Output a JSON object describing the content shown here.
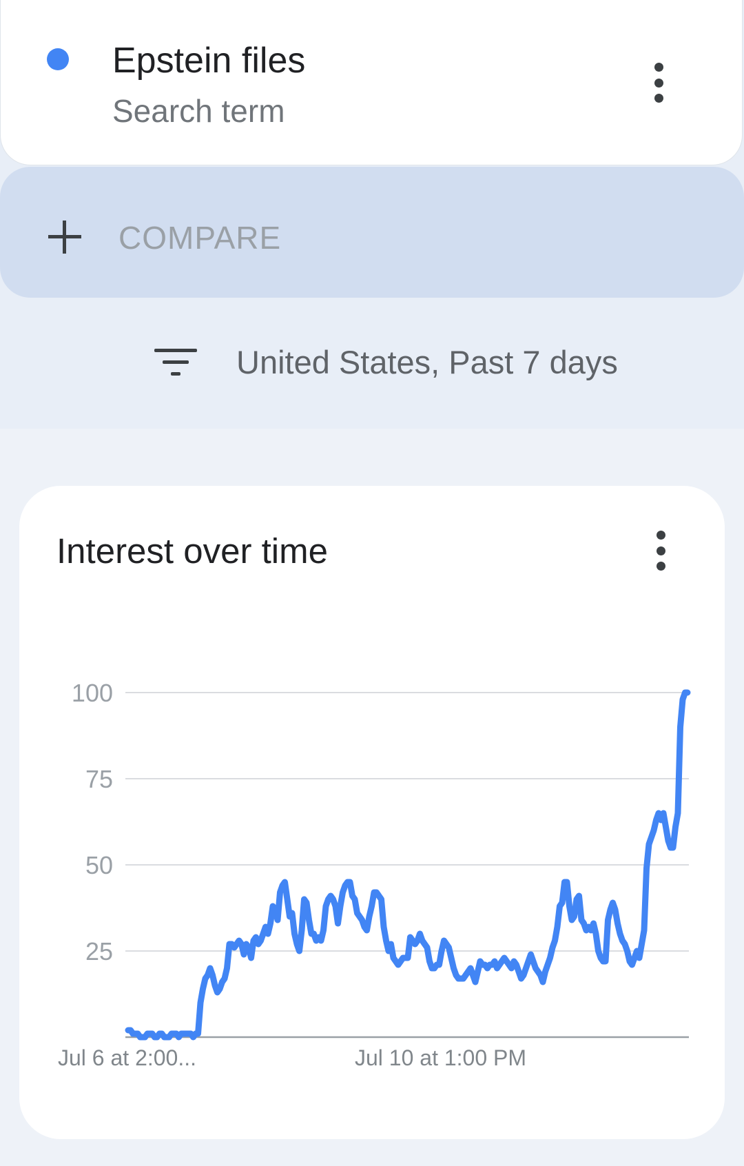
{
  "term": {
    "title": "Epstein files",
    "subtitle": "Search term",
    "dot_color": "#4285f4"
  },
  "compare": {
    "label": "COMPARE"
  },
  "filter": {
    "label": "United States, Past 7 days"
  },
  "chart_card": {
    "title": "Interest over time"
  },
  "chart_data": {
    "type": "line",
    "title": "Interest over time",
    "xlabel": "",
    "ylabel": "",
    "ylim": [
      0,
      100
    ],
    "yticks": [
      100,
      75,
      50,
      25
    ],
    "x_tick_labels": [
      "Jul 6 at 2:00...",
      "Jul 10 at 1:00 PM"
    ],
    "x_tick_positions": [
      0,
      100
    ],
    "grid": true,
    "legend": "none",
    "series": [
      {
        "color": "#4285f4",
        "values": [
          2,
          2,
          1,
          1,
          1,
          0,
          0,
          0,
          1,
          1,
          1,
          0,
          0,
          1,
          1,
          0,
          0,
          0,
          1,
          1,
          1,
          0,
          1,
          1,
          1,
          1,
          1,
          0,
          1,
          1,
          10,
          14,
          17,
          18,
          20,
          18,
          15,
          13,
          14,
          16,
          17,
          20,
          27,
          27,
          26,
          27,
          28,
          27,
          24,
          27,
          26,
          23,
          28,
          29,
          27,
          28,
          30,
          32,
          30,
          33,
          38,
          37,
          34,
          42,
          44,
          45,
          40,
          35,
          36,
          30,
          27,
          25,
          31,
          40,
          39,
          34,
          30,
          30,
          28,
          29,
          28,
          31,
          38,
          40,
          41,
          40,
          38,
          33,
          38,
          42,
          44,
          45,
          45,
          41,
          40,
          36,
          35,
          34,
          32,
          31,
          35,
          38,
          42,
          42,
          41,
          40,
          32,
          28,
          25,
          27,
          23,
          22,
          21,
          22,
          23,
          23,
          23,
          29,
          28,
          27,
          28,
          30,
          28,
          27,
          26,
          22,
          20,
          20,
          21,
          21,
          25,
          28,
          27,
          26,
          23,
          20,
          18,
          17,
          17,
          17,
          18,
          19,
          20,
          18,
          16,
          19,
          22,
          21,
          21,
          20,
          21,
          21,
          22,
          20,
          21,
          22,
          23,
          22,
          21,
          20,
          22,
          21,
          19,
          17,
          18,
          20,
          22,
          24,
          22,
          20,
          19,
          18,
          16,
          19,
          21,
          23,
          26,
          28,
          32,
          38,
          39,
          45,
          45,
          38,
          34,
          35,
          40,
          41,
          34,
          33,
          31,
          32,
          31,
          33,
          30,
          25,
          23,
          22,
          22,
          34,
          37,
          39,
          37,
          33,
          30,
          28,
          27,
          25,
          22,
          21,
          23,
          25,
          23,
          27,
          31,
          49,
          56,
          58,
          60,
          63,
          65,
          63,
          65,
          61,
          57,
          55,
          55,
          61,
          65,
          90,
          98,
          100,
          100
        ]
      }
    ]
  }
}
